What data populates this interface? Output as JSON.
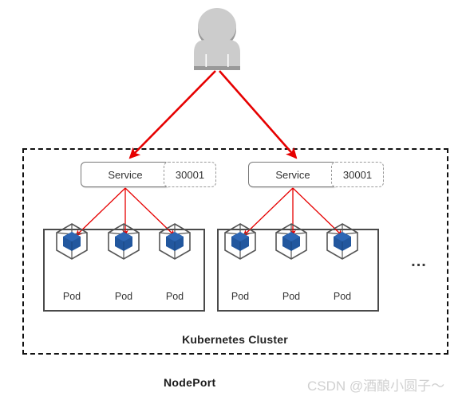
{
  "diagram": {
    "title": "NodePort",
    "cluster_label": "Kubernetes Cluster",
    "ellipsis": "...",
    "watermark": "CSDN @酒酿小圆子～",
    "colors": {
      "arrow_red": "#e60000",
      "pod_blue": "#22579e",
      "pod_outline": "#555555",
      "person_gray": "#cccccc",
      "person_shadow": "#999999",
      "cluster_border": "#111111",
      "node_border": "#4a4a4a",
      "watermark_gray": "#d0d0d0"
    }
  },
  "actor": {
    "name": "user-actor",
    "label": ""
  },
  "services": [
    {
      "label": "Service",
      "port": "30001"
    },
    {
      "label": "Service",
      "port": "30001"
    }
  ],
  "nodes": [
    {
      "pods": [
        {
          "label": "Pod"
        },
        {
          "label": "Pod"
        },
        {
          "label": "Pod"
        }
      ]
    },
    {
      "pods": [
        {
          "label": "Pod"
        },
        {
          "label": "Pod"
        },
        {
          "label": "Pod"
        }
      ]
    }
  ]
}
